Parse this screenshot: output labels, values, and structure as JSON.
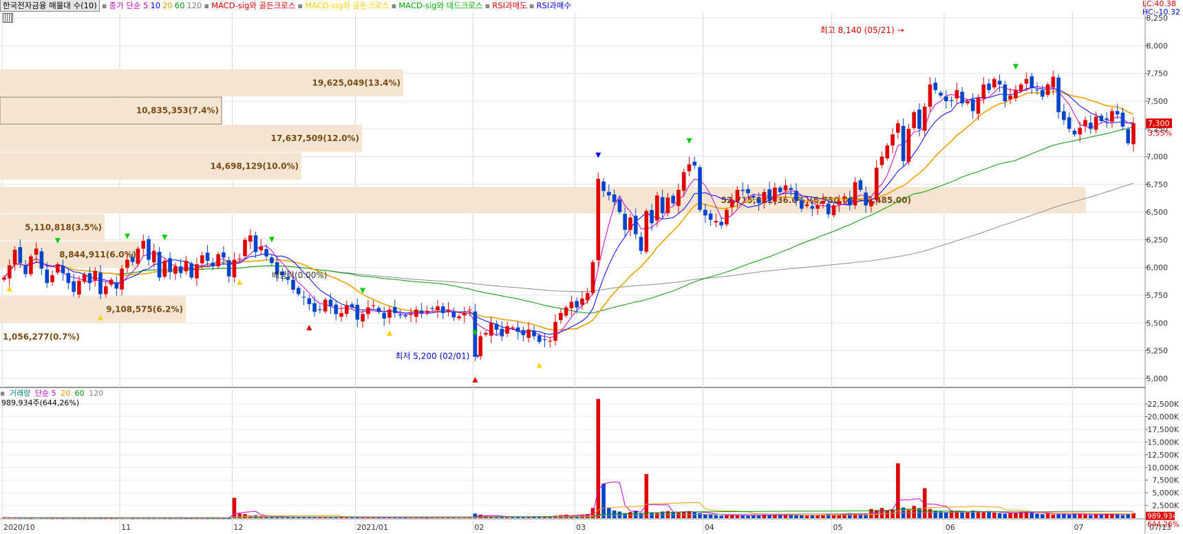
{
  "legend": {
    "title": "한국전자금융 매물대 수(10)",
    "items": [
      {
        "text": "종가 단순 5",
        "color": "#cc00cc"
      },
      {
        "text": "10",
        "color": "#0000ff"
      },
      {
        "text": "20",
        "color": "#e8a000"
      },
      {
        "text": "60",
        "color": "#009900"
      },
      {
        "text": "120",
        "color": "#808080"
      },
      {
        "text": "MACD-sig와 골든크로스",
        "color": "#e00000"
      },
      {
        "text": "MACD-sig와 골든크로스",
        "color": "#ffd200"
      },
      {
        "text": "MACD-sig와 데드크로스",
        "color": "#00b000"
      },
      {
        "text": "RSI과매도",
        "color": "#e00000"
      },
      {
        "text": "RSI과매수",
        "color": "#0000ff"
      }
    ]
  },
  "lc_text": "LC:40.38",
  "hc_text": "HC:-10.32",
  "volume_legend": {
    "items": [
      {
        "text": "거래량",
        "color": "#008080"
      },
      {
        "text": "단순 5",
        "color": "#cc00cc"
      },
      {
        "text": "20",
        "color": "#e8a000"
      },
      {
        "text": "60",
        "color": "#009900"
      },
      {
        "text": "120",
        "color": "#808080"
      }
    ],
    "current": "989,934주(644,26%)"
  },
  "chart_data": {
    "type": "candlestick",
    "price_axis": {
      "ticks": [
        5000,
        5250,
        5500,
        5750,
        6000,
        6250,
        6500,
        6750,
        7000,
        7250,
        7500,
        7750,
        8000,
        8250
      ],
      "labels": [
        "5,000",
        "5,250",
        "5,500",
        "5,750",
        "6,000",
        "6,250",
        "6,500",
        "6,750",
        "7,000",
        "7,250",
        "7,500",
        "7,750",
        "8,000",
        "8,250"
      ],
      "ylim": [
        4950,
        8300
      ]
    },
    "volume_axis": {
      "ticks": [
        2500,
        5000,
        7500,
        10000,
        12500,
        15000,
        17500,
        20000,
        22500
      ],
      "labels": [
        "2,500K",
        "5,000K",
        "7,500K",
        "10,000K",
        "12,500K",
        "15,000K",
        "17,500K",
        "20,000K",
        "22,500K"
      ],
      "ylim": [
        0,
        24000
      ]
    },
    "x_labels": [
      {
        "label": "2020/10",
        "idx": 0
      },
      {
        "label": "11",
        "idx": 22
      },
      {
        "label": "12",
        "idx": 43
      },
      {
        "label": "2021/01",
        "idx": 66
      },
      {
        "label": "02",
        "idx": 88
      },
      {
        "label": "03",
        "idx": 107
      },
      {
        "label": "04",
        "idx": 131
      },
      {
        "label": "05",
        "idx": 155
      },
      {
        "label": "06",
        "idx": 176
      },
      {
        "label": "07",
        "idx": 200
      },
      {
        "label": "07/13",
        "idx": 209
      }
    ],
    "current_price": {
      "label": "7,300",
      "change": "3.55%",
      "value": 7300
    },
    "current_volume": {
      "label": "989,934",
      "pct": "644.26%",
      "value": 990
    },
    "high_marker": {
      "text": "최고 8,140 (05/21)",
      "value": 8140
    },
    "low_marker": {
      "text": "최저 5,200 (02/01)",
      "value": 5200
    },
    "dividend_text": "배당락(0.00%)",
    "volume_profile": [
      {
        "label": "19,625,049(13.4%)",
        "price_low": 7540,
        "price_high": 7790
      },
      {
        "label": "10,835,353(7.4%)",
        "price_low": 7290,
        "price_high": 7540
      },
      {
        "label": "17,637,509(12.0%)",
        "price_low": 7040,
        "price_high": 7290
      },
      {
        "label": "14,698,129(10.0%)",
        "price_low": 6790,
        "price_high": 7040
      },
      {
        "label": "52,715,822(36.0%)(6,730.00 ~ 6,485.00)",
        "price_low": 6485,
        "price_high": 6730
      },
      {
        "label": "5,110,818(3.5%)",
        "price_low": 6240,
        "price_high": 6485
      },
      {
        "label": "8,844,911(6.0%)",
        "price_low": 5990,
        "price_high": 6240
      },
      {
        "label": "",
        "price_low": 5745,
        "price_high": 5990
      },
      {
        "label": "9,108,575(6.2%)",
        "price_low": 5500,
        "price_high": 5745
      },
      {
        "label": "1,056,277(0.7%)",
        "price_low": 5250,
        "price_high": 5500
      }
    ],
    "closes": [
      5910,
      6020,
      6160,
      6040,
      5940,
      6100,
      6170,
      5990,
      5860,
      5930,
      6030,
      5950,
      5860,
      5780,
      5880,
      5940,
      5860,
      5970,
      5760,
      5830,
      5890,
      5810,
      5990,
      6070,
      6050,
      6170,
      6240,
      6070,
      6150,
      5910,
      6060,
      5960,
      6010,
      5950,
      6060,
      5910,
      6030,
      6110,
      6060,
      6010,
      6120,
      6090,
      5920,
      6070,
      6080,
      6250,
      6290,
      6140,
      6190,
      6100,
      6040,
      5940,
      5930,
      5890,
      5800,
      5760,
      5730,
      5670,
      5600,
      5620,
      5710,
      5650,
      5580,
      5590,
      5660,
      5640,
      5530,
      5580,
      5640,
      5660,
      5600,
      5540,
      5620,
      5590,
      5570,
      5560,
      5580,
      5620,
      5590,
      5610,
      5630,
      5650,
      5590,
      5620,
      5550,
      5560,
      5590,
      5620,
      5200,
      5380,
      5410,
      5500,
      5440,
      5380,
      5470,
      5460,
      5420,
      5390,
      5440,
      5380,
      5330,
      5350,
      5340,
      5510,
      5590,
      5640,
      5690,
      5640,
      5720,
      5770,
      6050,
      6800,
      6690,
      6650,
      6590,
      6500,
      6340,
      6450,
      6300,
      6150,
      6510,
      6400,
      6650,
      6490,
      6630,
      6580,
      6700,
      6860,
      6930,
      6920,
      6520,
      6470,
      6430,
      6420,
      6380,
      6520,
      6610,
      6700,
      6690,
      6670,
      6630,
      6580,
      6680,
      6610,
      6720,
      6680,
      6740,
      6700,
      6600,
      6530,
      6570,
      6530,
      6560,
      6600,
      6480,
      6560,
      6600,
      6640,
      6560,
      6770,
      6700,
      6560,
      6600,
      6900,
      7000,
      7100,
      7200,
      7300,
      6960,
      7250,
      7400,
      7250,
      7450,
      7650,
      7600,
      7550,
      7500,
      7500,
      7600,
      7480,
      7500,
      7410,
      7530,
      7650,
      7600,
      7700,
      7650,
      7500,
      7550,
      7600,
      7650,
      7700,
      7620,
      7600,
      7540,
      7650,
      7720,
      7400,
      7330,
      7250,
      7200,
      7260,
      7330,
      7250,
      7360,
      7320,
      7330,
      7410,
      7380,
      7270,
      7120,
      7300
    ],
    "volumes": [
      150,
      120,
      110,
      90,
      100,
      80,
      130,
      90,
      100,
      80,
      90,
      70,
      110,
      90,
      80,
      70,
      90,
      80,
      70,
      80,
      60,
      80,
      100,
      120,
      80,
      90,
      100,
      80,
      90,
      110,
      80,
      70,
      90,
      80,
      60,
      70,
      80,
      90,
      70,
      60,
      80,
      70,
      60,
      4000,
      900,
      800,
      500,
      600,
      400,
      300,
      350,
      250,
      300,
      250,
      200,
      280,
      300,
      250,
      200,
      230,
      210,
      220,
      240,
      200,
      180,
      190,
      160,
      150,
      170,
      200,
      180,
      160,
      140,
      150,
      130,
      120,
      140,
      130,
      120,
      110,
      150,
      140,
      130,
      120,
      120,
      140,
      150,
      180,
      900,
      700,
      400,
      350,
      300,
      280,
      250,
      270,
      300,
      250,
      260,
      240,
      300,
      350,
      300,
      500,
      600,
      700,
      500,
      600,
      700,
      800,
      2000,
      23500,
      6800,
      2000,
      1500,
      1300,
      1000,
      1200,
      1500,
      1000,
      8700,
      1100,
      1000,
      1300,
      1400,
      1200,
      1100,
      1300,
      1400,
      1200,
      1000,
      800,
      700,
      600,
      500,
      550,
      650,
      600,
      500,
      450,
      500,
      600,
      700,
      650,
      600,
      550,
      600,
      650,
      700,
      600,
      500,
      550,
      600,
      700,
      800,
      700,
      600,
      900,
      1000,
      900,
      700,
      600,
      1800,
      1600,
      2000,
      1500,
      1700,
      10800,
      2100,
      1800,
      2400,
      2000,
      5900,
      1800,
      1500,
      1300,
      1200,
      1400,
      1300,
      1100,
      1300,
      1500,
      1400,
      1200,
      1300,
      1100,
      1000,
      900,
      1000,
      1100,
      1200,
      1300,
      1100,
      900,
      800,
      900,
      700,
      800,
      900,
      700,
      900,
      800,
      700,
      600,
      800,
      700,
      900,
      800,
      700,
      600,
      900,
      990
    ]
  }
}
